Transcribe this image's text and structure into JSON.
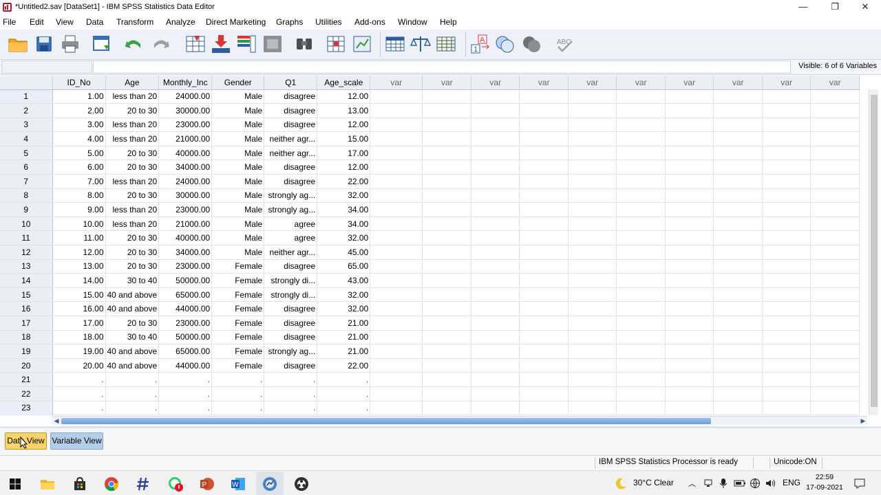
{
  "window": {
    "title": "*Untitled2.sav [DataSet1] - IBM SPSS Statistics Data Editor",
    "minimize": "—",
    "maximize": "❐",
    "close": "✕"
  },
  "menu": [
    "File",
    "Edit",
    "View",
    "Data",
    "Transform",
    "Analyze",
    "Direct Marketing",
    "Graphs",
    "Utilities",
    "Add-ons",
    "Window",
    "Help"
  ],
  "editbar": {
    "visible_label": "Visible: 6 of 6 Variables"
  },
  "grid": {
    "columns": [
      "ID_No",
      "Age",
      "Monthly_Inc",
      "Gender",
      "Q1",
      "Age_scale",
      "var",
      "var",
      "var",
      "var",
      "var",
      "var",
      "var",
      "var",
      "var",
      "var"
    ],
    "rows": [
      [
        "1",
        "1.00",
        "less than 20",
        "24000.00",
        "Male",
        "disagree",
        "12.00"
      ],
      [
        "2",
        "2.00",
        "20 to 30",
        "30000.00",
        "Male",
        "disagree",
        "13.00"
      ],
      [
        "3",
        "3.00",
        "less than 20",
        "23000.00",
        "Male",
        "disagree",
        "12.00"
      ],
      [
        "4",
        "4.00",
        "less than 20",
        "21000.00",
        "Male",
        "neither agr...",
        "15.00"
      ],
      [
        "5",
        "5.00",
        "20 to 30",
        "40000.00",
        "Male",
        "neither agr...",
        "17.00"
      ],
      [
        "6",
        "6.00",
        "20 to 30",
        "34000.00",
        "Male",
        "disagree",
        "12.00"
      ],
      [
        "7",
        "7.00",
        "less than 20",
        "24000.00",
        "Male",
        "disagree",
        "22.00"
      ],
      [
        "8",
        "8.00",
        "20 to 30",
        "30000.00",
        "Male",
        "strongly ag...",
        "32.00"
      ],
      [
        "9",
        "9.00",
        "less than 20",
        "23000.00",
        "Male",
        "strongly ag...",
        "34.00"
      ],
      [
        "10",
        "10.00",
        "less than 20",
        "21000.00",
        "Male",
        "agree",
        "34.00"
      ],
      [
        "11",
        "11.00",
        "20 to 30",
        "40000.00",
        "Male",
        "agree",
        "32.00"
      ],
      [
        "12",
        "12.00",
        "20 to 30",
        "34000.00",
        "Male",
        "neither agr...",
        "45.00"
      ],
      [
        "13",
        "13.00",
        "20 to 30",
        "23000.00",
        "Female",
        "disagree",
        "65.00"
      ],
      [
        "14",
        "14.00",
        "30 to 40",
        "50000.00",
        "Female",
        "strongly di...",
        "43.00"
      ],
      [
        "15",
        "15.00",
        "40 and above",
        "65000.00",
        "Female",
        "strongly di...",
        "32.00"
      ],
      [
        "16",
        "16.00",
        "40 and above",
        "44000.00",
        "Female",
        "disagree",
        "32.00"
      ],
      [
        "17",
        "17.00",
        "20 to 30",
        "23000.00",
        "Female",
        "disagree",
        "21.00"
      ],
      [
        "18",
        "18.00",
        "30 to 40",
        "50000.00",
        "Female",
        "disagree",
        "21.00"
      ],
      [
        "19",
        "19.00",
        "40 and above",
        "65000.00",
        "Female",
        "strongly ag...",
        "21.00"
      ],
      [
        "20",
        "20.00",
        "40 and above",
        "44000.00",
        "Female",
        "disagree",
        "22.00"
      ],
      [
        "21",
        ".",
        ".",
        ".",
        ".",
        ".",
        "."
      ],
      [
        "22",
        ".",
        ".",
        ".",
        ".",
        ".",
        "."
      ],
      [
        "23",
        ".",
        ".",
        ".",
        ".",
        ".",
        "."
      ]
    ]
  },
  "tabs": {
    "data_view": "Data View",
    "variable_view": "Variable View"
  },
  "status": {
    "processor": "IBM SPSS Statistics Processor is ready",
    "unicode": "Unicode:ON"
  },
  "taskbar": {
    "weather": "30°C  Clear",
    "lang": "ENG",
    "time": "22:59",
    "date": "17-09-2021"
  },
  "colors": {
    "active_tab": "#f7d36b",
    "inactive_tab": "#b4cde8",
    "header_bg": "#eaeff7"
  }
}
